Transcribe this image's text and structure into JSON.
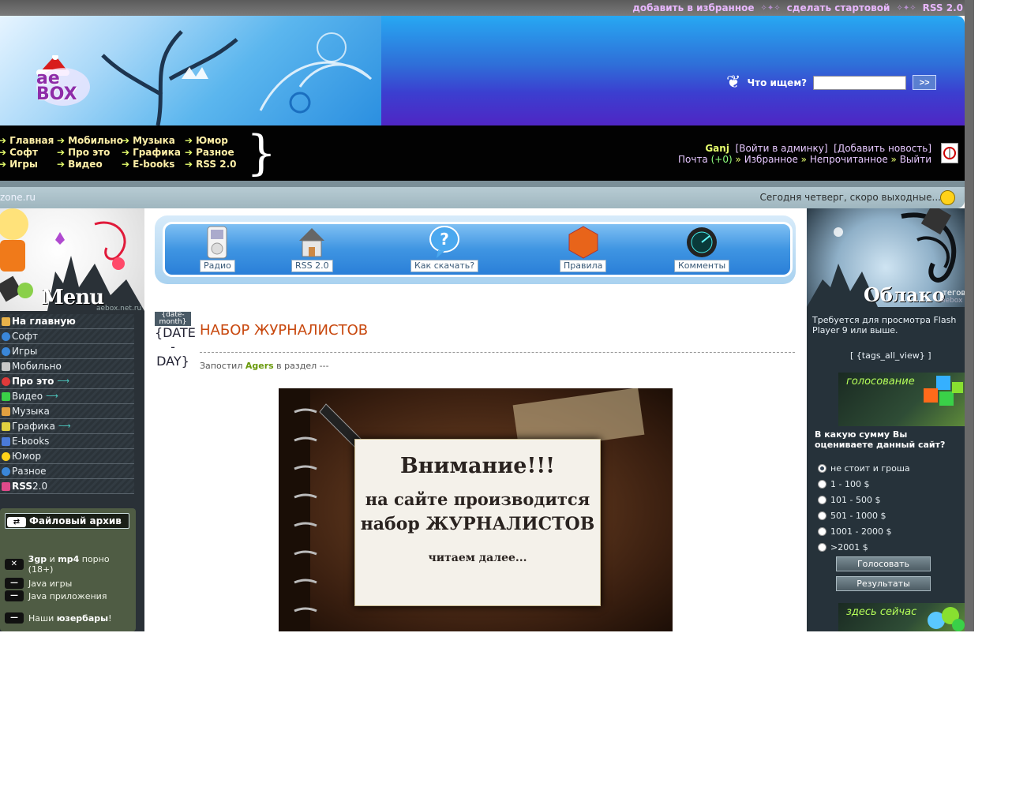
{
  "toplinks": {
    "favorite": "добавить в избранное",
    "homepage": "сделать стартовой",
    "rss": "RSS 2.0"
  },
  "header": {
    "logo_text": "ae BOX",
    "search_label": "Что ищем?",
    "search_value": "",
    "search_button": ">>"
  },
  "nav": {
    "col1": [
      "Главная",
      "Софт",
      "Игры"
    ],
    "col2": [
      "Мобильно",
      "Про это",
      "Видео"
    ],
    "col3": [
      "Музыка",
      "Графика",
      "E-books"
    ],
    "col4": [
      "Юмор",
      "Разное",
      "RSS 2.0"
    ]
  },
  "user": {
    "name": "Ganj",
    "admin_link": "[Войти в админку]",
    "add_news": "[Добавить новость]",
    "mail": "Почта",
    "mail_count": "(+0)",
    "favorites": "Избранное",
    "unread": "Непрочитанное",
    "logout": "Выйти"
  },
  "infobar": {
    "left": "zone.ru",
    "right": "Сегодня четверг, скоро выходные..."
  },
  "sidebar": {
    "title": "Menu",
    "site": "aebox.net.ru",
    "items": [
      {
        "label": "На главную",
        "bold": true,
        "color": "#e8b24a"
      },
      {
        "label": "Софт",
        "bold": false,
        "color": "#3a86d8"
      },
      {
        "label": "Игры",
        "bold": false,
        "color": "#3a86d8"
      },
      {
        "label": "Мобильно",
        "bold": false,
        "color": "#c8c8c8"
      },
      {
        "label": "Про это",
        "bold": true,
        "color": "#e03a3a"
      },
      {
        "label": "Видео",
        "bold": false,
        "color": "#3ad048"
      },
      {
        "label": "Музыка",
        "bold": false,
        "color": "#e0a040"
      },
      {
        "label": "Графика",
        "bold": false,
        "color": "#e0d040"
      },
      {
        "label": "E-books",
        "bold": false,
        "color": "#4a7ad8"
      },
      {
        "label": "Юмор",
        "bold": false,
        "color": "#ffd21a"
      },
      {
        "label": "Разное",
        "bold": false,
        "color": "#3a86d8"
      },
      {
        "label": "RSS",
        "suffix": " 2.0",
        "bold": true,
        "color": "#e04a8a"
      }
    ],
    "tail_arrows": [
      "Про это",
      "Видео",
      "Графика"
    ]
  },
  "archive": {
    "title": "Файловый архив",
    "row1_a": "3gp",
    "row1_mid": " и ",
    "row1_b": "mp4",
    "row1_rest": " порно (18+)",
    "row2": "Java игры",
    "row3": "Java приложения",
    "row4_pre": "Наши ",
    "row4_b": "юзербары",
    "row4_post": "!"
  },
  "iconbar": {
    "radio": "Радио",
    "rss": "RSS 2.0",
    "howto": "Как скачать?",
    "rules": "Правила",
    "comments": "Комменты"
  },
  "post": {
    "date_month": "{date-month}",
    "date_day": "{DATE - DAY}",
    "title": "НАБОР ЖУРНАЛИСТОВ",
    "meta_pre": "Запостил ",
    "author": "Agers",
    "meta_post": " в раздел ---",
    "img_line1": "Внимание!!!",
    "img_line2": "на сайте производится",
    "img_line3": "набор ЖУРНАЛИСТОВ",
    "img_line4": "читаем далее..."
  },
  "rightcol": {
    "cloud_title": "Облако",
    "cloud_sub": "тегов",
    "cloud_site": "aebox",
    "flash_text": "Требуется для просмотра Flash Player 9 или выше.",
    "tags_all": "[ {tags_all_view} ]",
    "vote_head": "голосование",
    "vote_question": "В какую сумму Вы оцениваете данный сайт?",
    "vote_options": [
      "не стоит и гроша",
      "1 - 100 $",
      "101 - 500 $",
      "501 - 1000 $",
      "1001 - 2000 $",
      ">2001 $"
    ],
    "vote_selected": 0,
    "vote_button": "Голосовать",
    "results_button": "Результаты",
    "now_head": "здесь сейчас"
  }
}
